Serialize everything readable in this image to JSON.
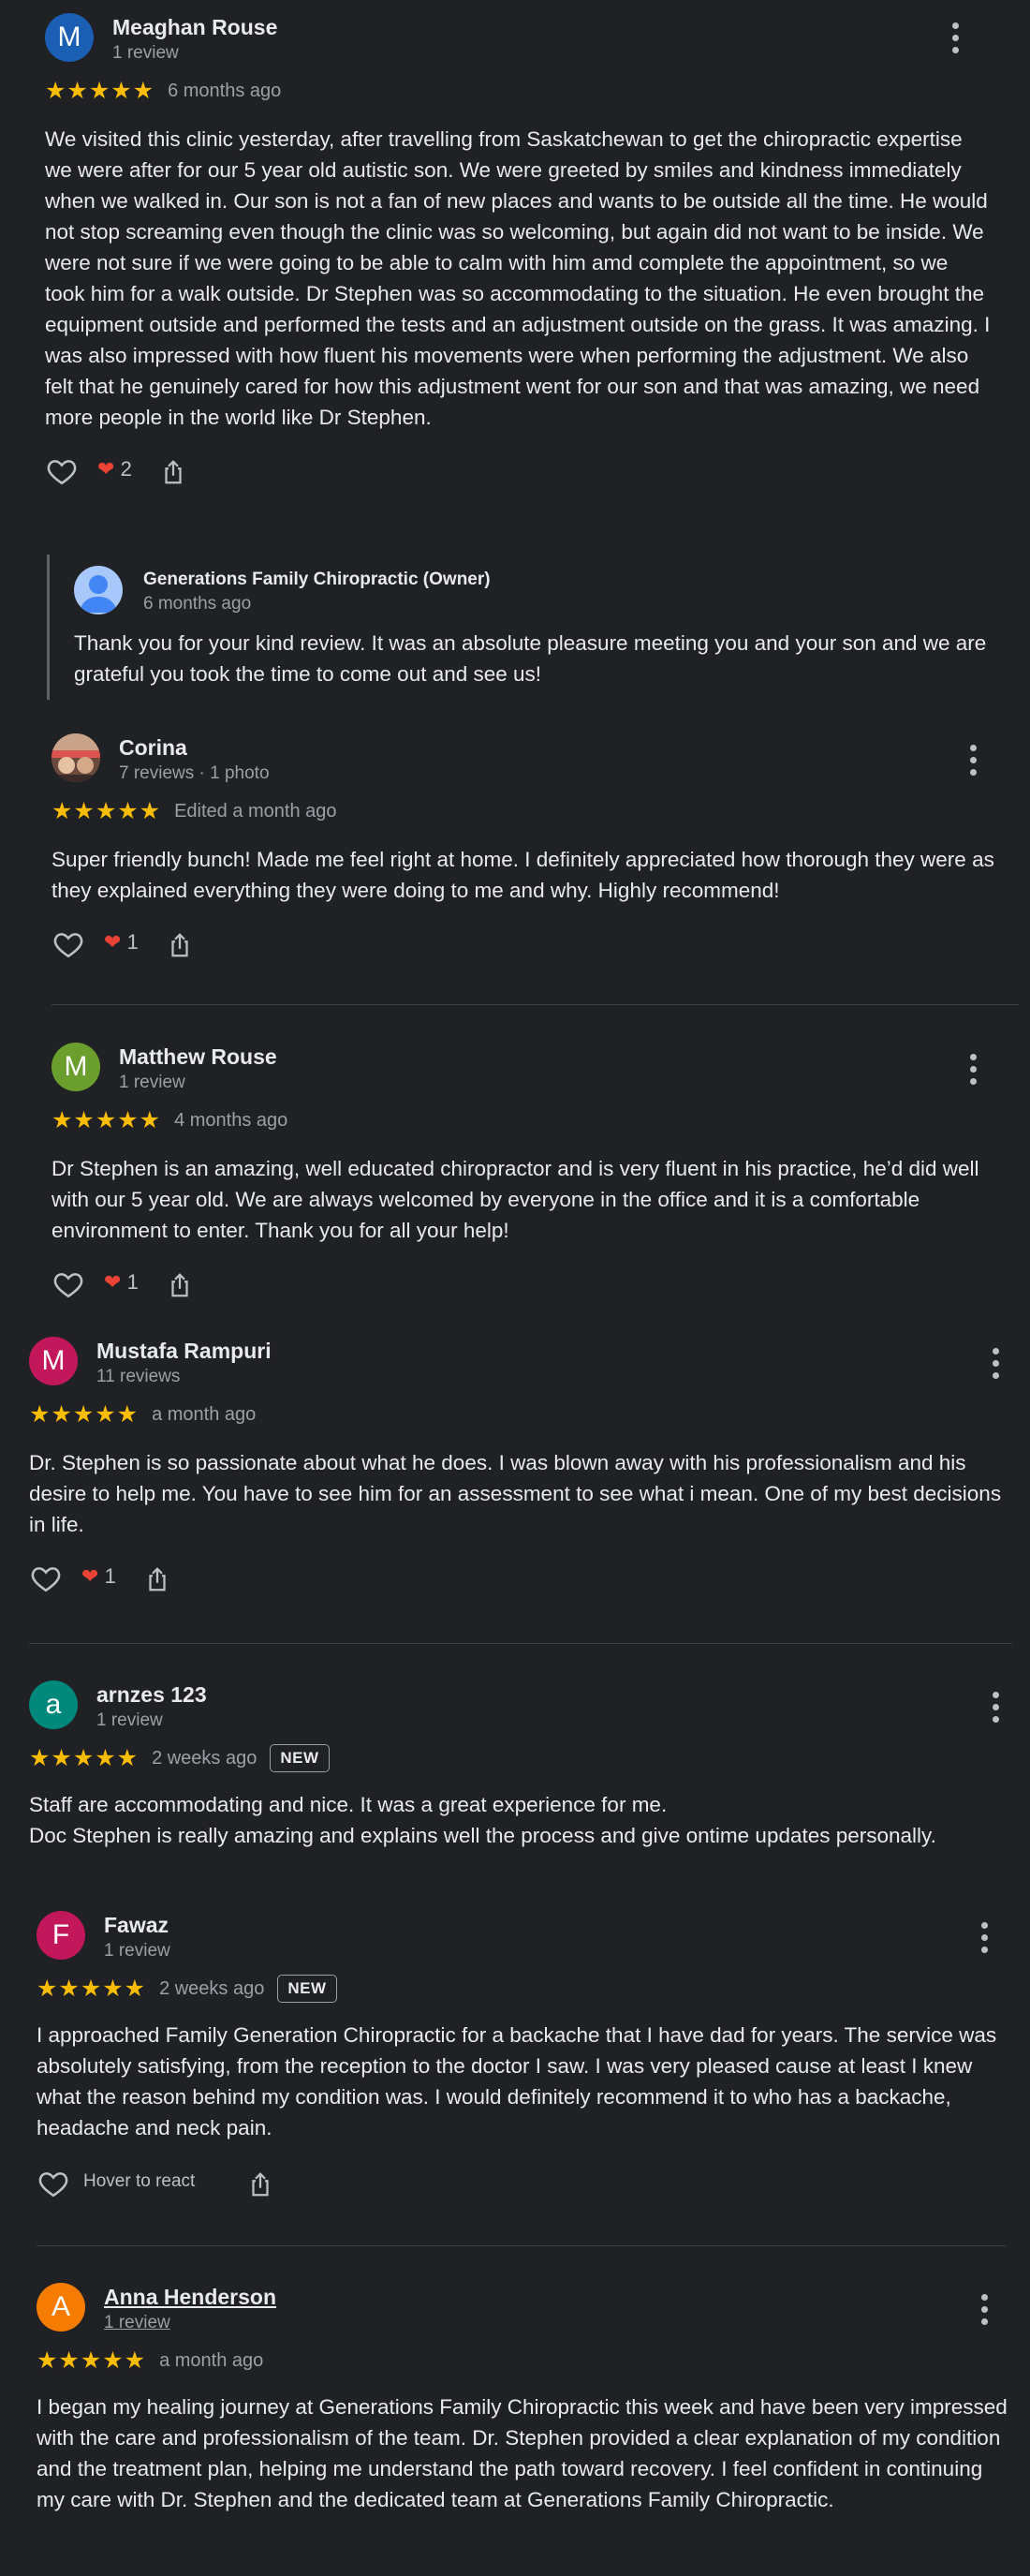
{
  "reviews": [
    {
      "initial": "M",
      "avatar_color": "#1a5fb4",
      "name": "Meaghan Rouse",
      "sub": "1 review",
      "stars": "★★★★★",
      "when": "6 months ago",
      "text": "We visited this clinic yesterday, after travelling from Saskatchewan to get the chiropractic expertise we were after for our 5 year old autistic son. We were greeted by smiles and kindness immediately when we walked in. Our son is not a fan of new places and wants to be outside all the time. He would not stop screaming even though the clinic was so welcoming, but again did not want to be inside. We were not sure if we were going to be able to calm with him amd complete the appointment, so we took him for a walk outside. Dr Stephen was so accommodating to the situation. He even brought the equipment outside and performed the tests and an adjustment outside on the grass. It was amazing. I was also impressed with how fluent his movements were when performing the adjustment. We also felt that he genuinely cared for how this adjustment went for our son and that was amazing, we need more people in the world like Dr Stephen.",
      "reactions": "2"
    },
    {
      "initial": "",
      "avatar_color": "#b35b5b",
      "name": "Corina",
      "sub": "7 reviews · 1 photo",
      "stars": "★★★★★",
      "when": "Edited a month ago",
      "text": "Super friendly bunch! Made me feel right at home. I definitely appreciated how thorough they were as they explained everything they were doing to me and why. Highly recommend!",
      "reactions": "1"
    },
    {
      "initial": "M",
      "avatar_color": "#6a9f2e",
      "name": "Matthew Rouse",
      "sub": "1 review",
      "stars": "★★★★★",
      "when": "4 months ago",
      "text": "Dr Stephen is an amazing, well educated chiropractor and is very fluent in his practice, he’d did well with our 5 year old. We are always welcomed by everyone in the office and it is a comfortable environment to enter. Thank you for all your help!",
      "reactions": "1"
    },
    {
      "initial": "M",
      "avatar_color": "#c2185b",
      "name": "Mustafa Rampuri",
      "sub": "11 reviews",
      "stars": "★★★★★",
      "when": "a month ago",
      "text": "Dr. Stephen is so passionate about what he does. I was blown away with his professionalism and his desire to help me. You have to see him for an assessment to see what i mean. One of my best decisions in life.",
      "reactions": "1"
    },
    {
      "initial": "a",
      "avatar_color": "#00897b",
      "name": "arnzes 123",
      "sub": "1 review",
      "stars": "★★★★★",
      "when": "2 weeks ago",
      "badge": "NEW",
      "text": "Staff are accommodating and nice. It was a great experience for me.\nDoc Stephen is really amazing and explains well the process and give ontime updates personally."
    },
    {
      "initial": "F",
      "avatar_color": "#c2185b",
      "name": "Fawaz",
      "sub": "1 review",
      "stars": "★★★★★",
      "when": "2 weeks ago",
      "badge": "NEW",
      "text": "I approached Family Generation Chiropractic for a backache that I have dad for years. The service was absolutely satisfying, from the reception to the doctor I saw. I was very pleased cause at least I knew what the reason behind my condition was. I would definitely recommend it to who has a backache, headache and neck pain.",
      "hover_label": "Hover to react"
    },
    {
      "initial": "A",
      "avatar_color": "#f57c00",
      "name": "Anna Henderson",
      "sub": "1 review",
      "stars": "★★★★★",
      "when": "a month ago",
      "text": "I began my healing journey at Generations Family Chiropractic this week and have been very impressed with the care and professionalism of the team. Dr. Stephen provided a clear explanation of my condition and the treatment plan, helping me understand the path toward recovery. I feel confident in continuing my care with Dr. Stephen and the dedicated team at Generations Family Chiropractic."
    }
  ],
  "owner_reply": {
    "name": "Generations Family Chiropractic (Owner)",
    "when": "6 months ago",
    "text": "Thank you for your kind review. It was an absolute pleasure meeting you and your son and we are grateful you took the time to come out and see us!"
  },
  "icons": {
    "like": "heart-outline-icon",
    "reaction": "red-heart-icon",
    "share": "share-icon",
    "more": "more-vert-icon"
  }
}
